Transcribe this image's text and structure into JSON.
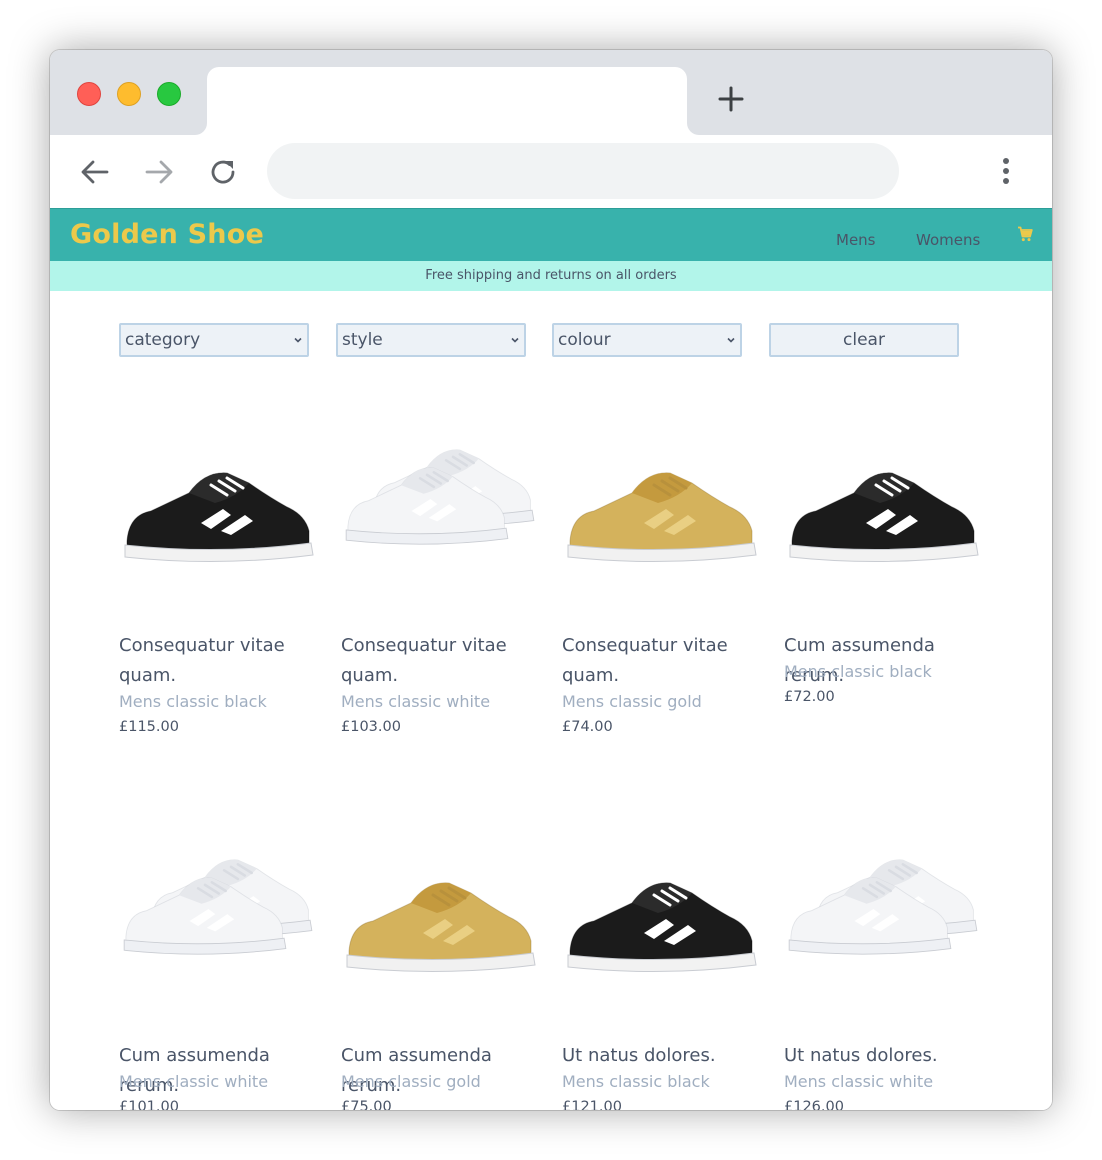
{
  "browser": {
    "new_tab_icon": "plus-icon",
    "back_icon": "arrow-left-icon",
    "forward_icon": "arrow-right-icon",
    "reload_icon": "reload-icon",
    "menu_icon": "kebab-menu-icon"
  },
  "site": {
    "logo": "Golden Shoe",
    "nav": {
      "mens": "Mens",
      "womens": "Womens"
    },
    "cart_icon": "cart-icon",
    "banner": "Free shipping and returns on all orders",
    "colors": {
      "header": "#38b2ac",
      "logo": "#ecc94b",
      "banner": "#b2f5ea"
    }
  },
  "filters": {
    "category": "category",
    "style": "style",
    "colour": "colour",
    "clear": "clear"
  },
  "products": [
    {
      "name": "Consequatur vitae quam.",
      "subtitle": "Mens classic black",
      "price": "£115.00",
      "color": "black"
    },
    {
      "name": "Consequatur vitae quam.",
      "subtitle": "Mens classic white",
      "price": "£103.00",
      "color": "white"
    },
    {
      "name": "Consequatur vitae quam.",
      "subtitle": "Mens classic gold",
      "price": "£74.00",
      "color": "gold"
    },
    {
      "name": "Cum assumenda rerum.",
      "subtitle": "Mens classic black",
      "price": "£72.00",
      "color": "black"
    },
    {
      "name": "Cum assumenda rerum.",
      "subtitle": "Mens classic white",
      "price": "£101.00",
      "color": "white"
    },
    {
      "name": "Cum assumenda rerum.",
      "subtitle": "Mens classic gold",
      "price": "£75.00",
      "color": "gold"
    },
    {
      "name": "Ut natus dolores.",
      "subtitle": "Mens classic black",
      "price": "£121.00",
      "color": "black"
    },
    {
      "name": "Ut natus dolores.",
      "subtitle": "Mens classic white",
      "price": "£126.00",
      "color": "white"
    }
  ]
}
